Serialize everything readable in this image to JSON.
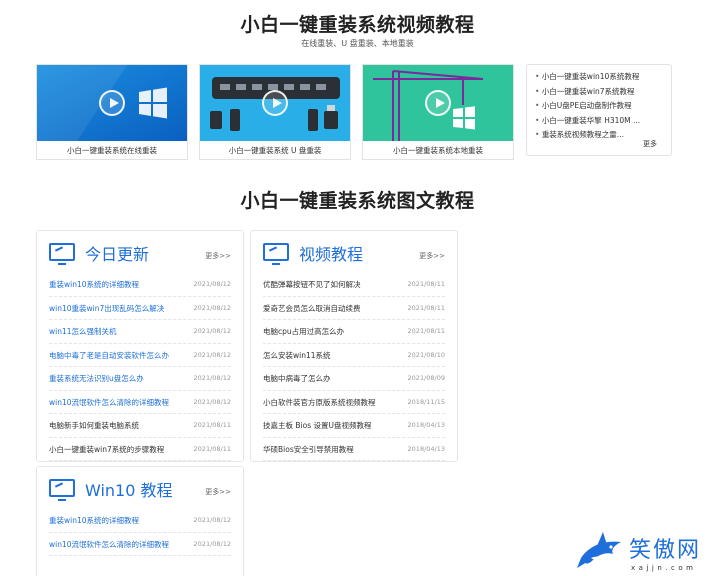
{
  "video_section": {
    "title": "小白一键重装系统视频教程",
    "subtitle": "在线重装、U 盘重装、本地重装",
    "cards": [
      {
        "caption": "小白一键重装系统在线重装"
      },
      {
        "caption": "小白一键重装系统 U 盘重装"
      },
      {
        "caption": "小白一键重装系统本地重装"
      }
    ],
    "side_list": [
      "小白一键重装win10系统教程",
      "小白一键重装win7系统教程",
      "小白U盘PE启动盘制作教程",
      "小白一键重装华擎 H310M ...",
      "重装系统视频教程之雷..."
    ],
    "side_more": "更多"
  },
  "article_section": {
    "title": "小白一键重装系统图文教程"
  },
  "panels": {
    "today": {
      "title": "今日更新",
      "more": "更多>>",
      "items": [
        {
          "text": "重装win10系统的详细教程",
          "date": "2021/08/12",
          "style": "blue"
        },
        {
          "text": "win10重装win7出现乱码怎么解决",
          "date": "2021/08/12",
          "style": "blue"
        },
        {
          "text": "win11怎么强制关机",
          "date": "2021/08/12",
          "style": "blue"
        },
        {
          "text": "电脑中毒了老是自动安装软件怎么办",
          "date": "2021/08/12",
          "style": "blue"
        },
        {
          "text": "重装系统无法识别u盘怎么办",
          "date": "2021/08/12",
          "style": "blue"
        },
        {
          "text": "win10流氓软件怎么清除的详细教程",
          "date": "2021/08/12",
          "style": "blue"
        },
        {
          "text": "电脑新手如何重装电脑系统",
          "date": "2021/08/11",
          "style": "dark"
        },
        {
          "text": "小白一键重装win7系统的步骤教程",
          "date": "2021/08/11",
          "style": "dark"
        }
      ]
    },
    "video": {
      "title": "视频教程",
      "more": "更多>>",
      "items": [
        {
          "text": "优酷弹幕按钮不见了如何解决",
          "date": "2021/08/11",
          "style": "dark"
        },
        {
          "text": "爱奇艺会员怎么取消自动续费",
          "date": "2021/08/11",
          "style": "dark"
        },
        {
          "text": "电脑cpu占用过高怎么办",
          "date": "2021/08/11",
          "style": "dark"
        },
        {
          "text": "怎么安装win11系统",
          "date": "2021/08/10",
          "style": "dark"
        },
        {
          "text": "电脑中病毒了怎么办",
          "date": "2021/08/09",
          "style": "dark"
        },
        {
          "text": "小白软件装官方原版系统视频教程",
          "date": "2018/11/15",
          "style": "dark"
        },
        {
          "text": "技嘉主板 Bios 设置U盘视频教程",
          "date": "2018/04/13",
          "style": "dark"
        },
        {
          "text": "华硕Bios安全引导禁用教程",
          "date": "2018/04/13",
          "style": "dark"
        }
      ]
    },
    "win10": {
      "title": "Win10 教程",
      "more": "更多>>",
      "items": [
        {
          "text": "重装win10系统的详细教程",
          "date": "2021/08/12",
          "style": "blue"
        },
        {
          "text": "win10流氓软件怎么清除的详细教程",
          "date": "2021/08/12",
          "style": "blue"
        }
      ]
    }
  },
  "logo": {
    "name": "笑傲网",
    "url": "xajjn.com"
  },
  "colors": {
    "accent": "#1e6fd9"
  }
}
